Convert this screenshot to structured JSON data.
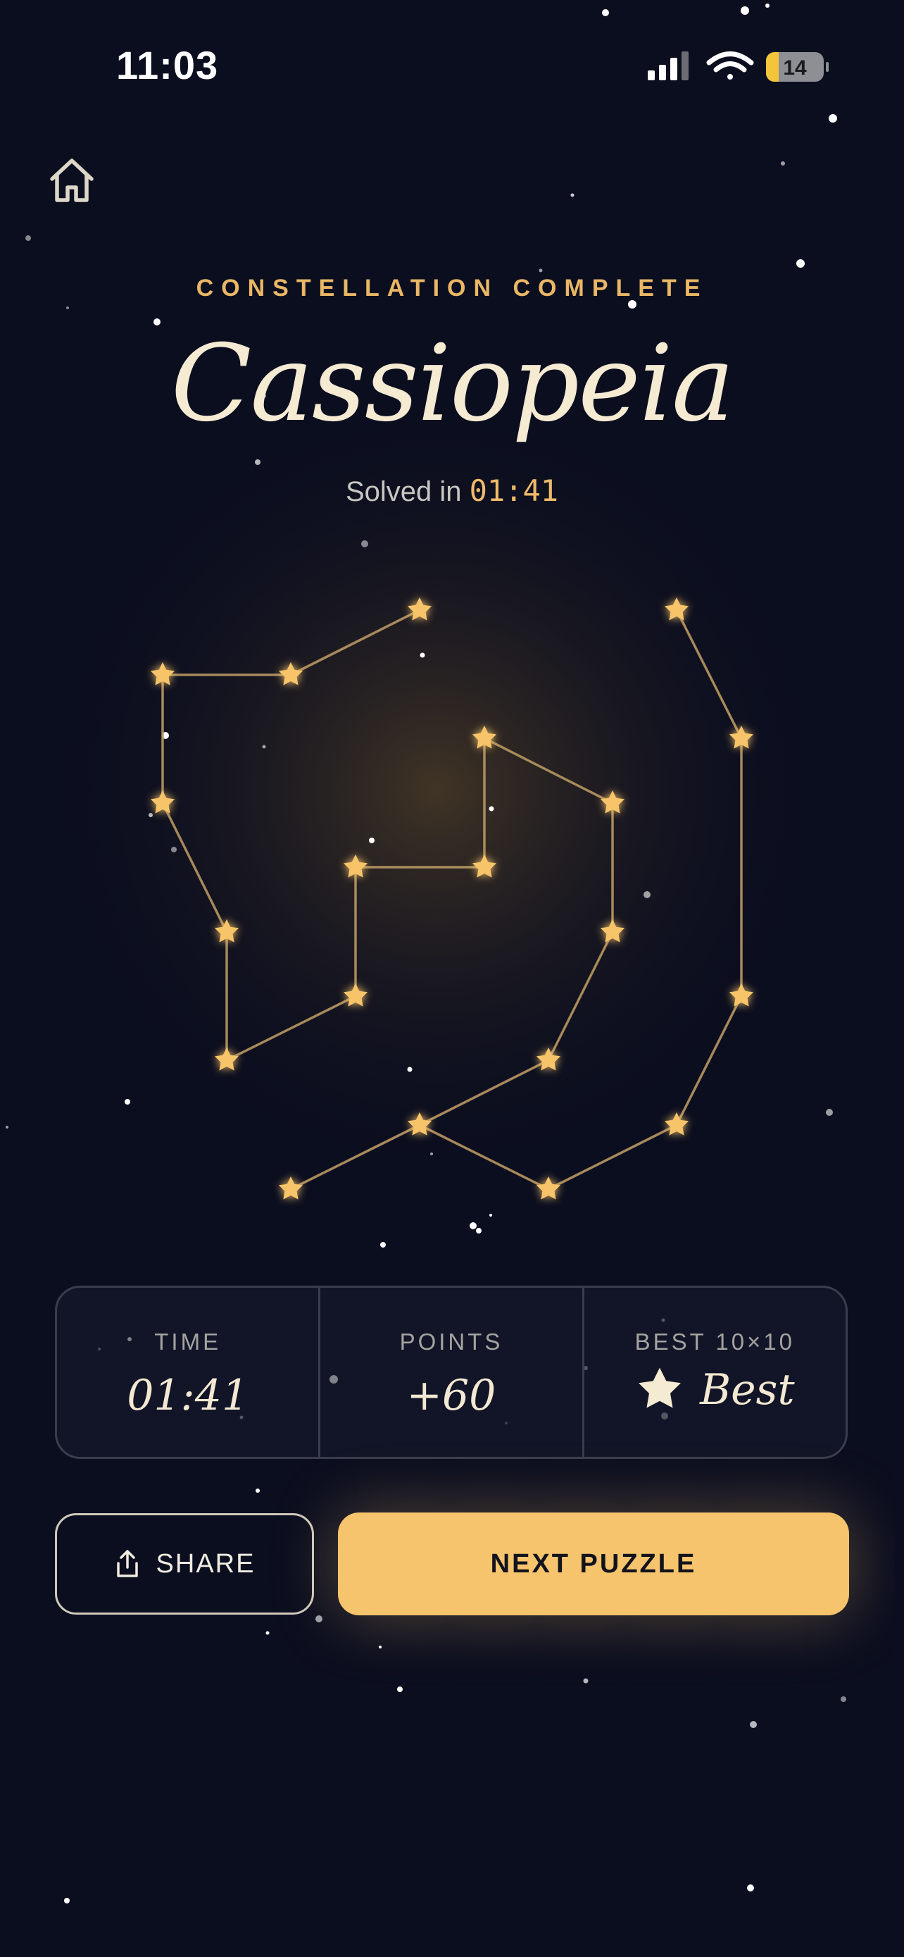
{
  "status_bar": {
    "time": "11:03",
    "battery_level": "14",
    "icons": [
      "cellular-signal-icon",
      "wifi-icon",
      "battery-icon"
    ]
  },
  "header": {
    "home_icon": "home-icon",
    "kicker": "CONSTELLATION COMPLETE",
    "title": "Cassiopeia",
    "solved_prefix": "Solved in ",
    "solved_time": "01:41"
  },
  "stats": [
    {
      "label": "TIME",
      "value": "01:41"
    },
    {
      "label": "POINTS",
      "value": "+60"
    },
    {
      "label": "BEST 10×10",
      "value": "Best",
      "icon": "star-icon"
    }
  ],
  "actions": {
    "share_label": "SHARE",
    "share_icon": "share-icon",
    "next_label": "NEXT PUZZLE"
  },
  "colors": {
    "background": "#0b0e1f",
    "accent": "#f5c46d",
    "kicker": "#e9b765",
    "title": "#f5ead2"
  }
}
